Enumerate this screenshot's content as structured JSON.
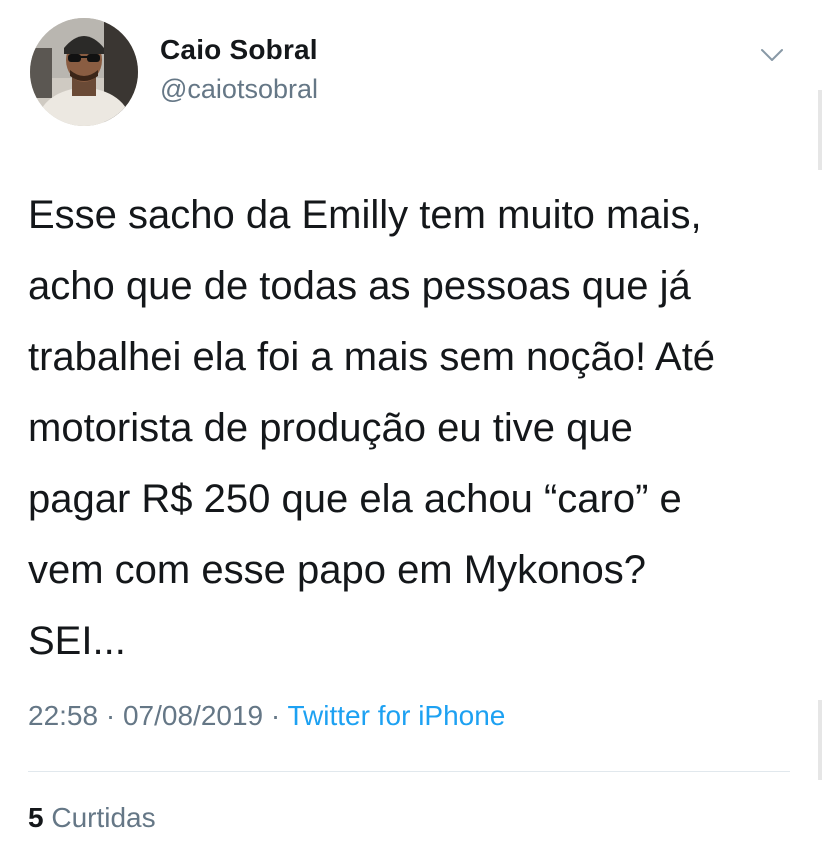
{
  "user": {
    "name": "Caio Sobral",
    "handle": "@caiotsobral",
    "avatar_icon": "profile-photo"
  },
  "tweet": {
    "text_lines": [
      "Esse sacho da Emilly tem muito mais,",
      "acho que de todas as pessoas que já",
      "trabalhei ela foi a mais sem noção! Até",
      "motorista de produção eu tive que",
      "pagar R$ 250 que ela achou “caro” e",
      "vem com esse papo em Mykonos?",
      "SEI..."
    ],
    "time": "22:58",
    "date": "07/08/2019",
    "separator": "·",
    "source": "Twitter for iPhone"
  },
  "stats": {
    "likes_count": "5",
    "likes_label": "Curtidas"
  },
  "icons": {
    "menu": "chevron-down-icon"
  },
  "colors": {
    "text": "#14171a",
    "secondary": "#657786",
    "link": "#1da1f2",
    "divider": "#e1e8ed"
  }
}
